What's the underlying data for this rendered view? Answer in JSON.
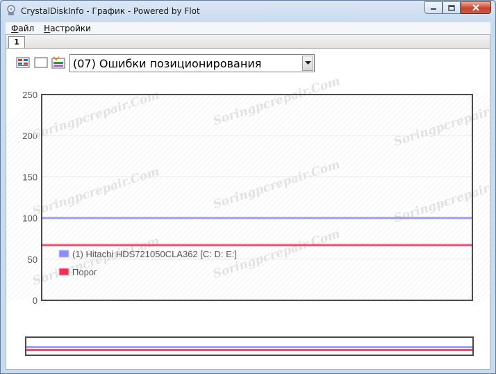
{
  "window": {
    "title": "CrystalDiskInfo - График - Powered by Flot"
  },
  "menu": [
    {
      "label": "Файл",
      "hotkey": "Ф",
      "rest": "айл"
    },
    {
      "label": "Настройки",
      "hotkey": "Н",
      "rest": "астройки"
    }
  ],
  "tabs": [
    "1"
  ],
  "toolbar": {
    "icons": [
      "select-disks-icon",
      "blank-icon",
      "settings-icon"
    ],
    "attribute_select": "(07) Ошибки позиционирования"
  },
  "chart_data": {
    "type": "line",
    "ylim": [
      0,
      250
    ],
    "yticks": [
      0,
      50,
      100,
      150,
      200,
      250
    ],
    "grid": true,
    "legend": "bottom-left",
    "series": [
      {
        "name": "(1) Hitachi HDS721050CLA362 [C: D: E:]",
        "values": [
          100,
          100
        ],
        "color": "#8c8cff"
      },
      {
        "name": "Порог",
        "values": [
          67,
          67
        ],
        "color": "#ff2a55"
      }
    ]
  },
  "watermark": "Soringpcrepair.Com",
  "colors": {
    "frame": "#c9dbef",
    "axis": "#4a4a4a",
    "grid": "#e6e6e6"
  }
}
